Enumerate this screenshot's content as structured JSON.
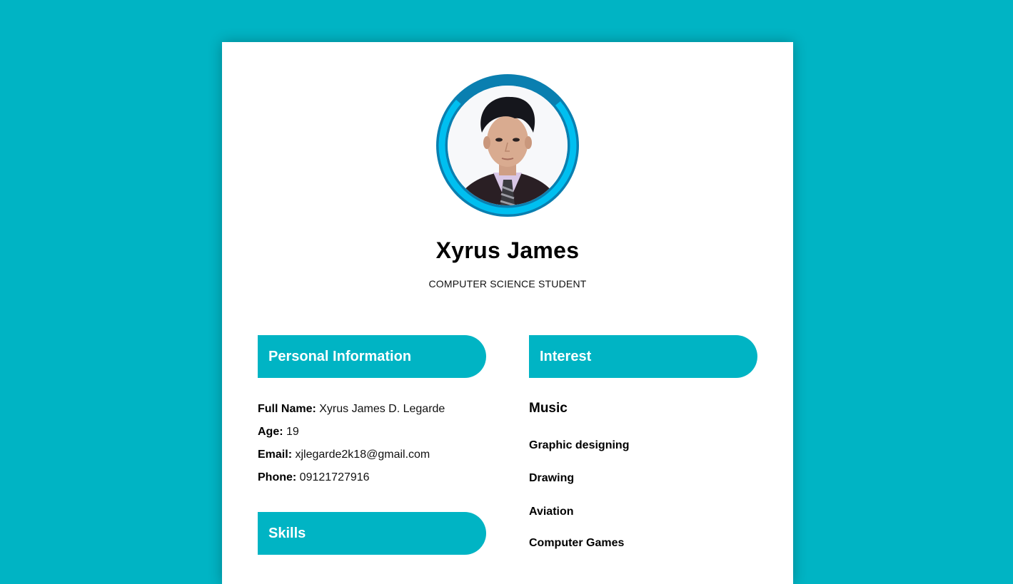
{
  "profile": {
    "name": "Xyrus James",
    "title": "COMPUTER SCIENCE STUDENT",
    "photo_alt": "profile-photo"
  },
  "sections": {
    "personal": "Personal Information",
    "interest": "Interest",
    "skills": "Skills"
  },
  "personal_info": [
    {
      "label": "Full Name:",
      "value": "Xyrus James D. Legarde"
    },
    {
      "label": "Age:",
      "value": "19"
    },
    {
      "label": "Email:",
      "value": "xjlegarde2k18@gmail.com"
    },
    {
      "label": "Phone:",
      "value": "09121727916"
    }
  ],
  "interests": {
    "primary": "Music",
    "items": [
      "Graphic designing",
      "Drawing",
      "Aviation",
      "Computer Games"
    ]
  },
  "colors": {
    "background": "#00b4c4",
    "accent": "#00b4c4",
    "ring_dark": "#0a7fb0",
    "ring_light": "#00bff0"
  }
}
